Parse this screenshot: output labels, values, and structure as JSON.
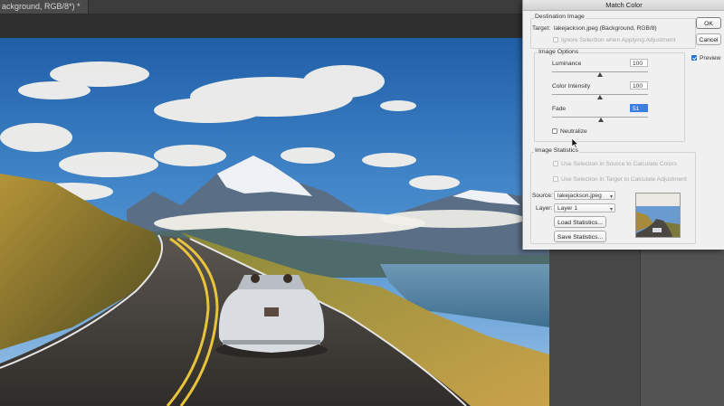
{
  "document": {
    "tab_title": "ackground, RGB/8*) *"
  },
  "dialog": {
    "title": "Match Color",
    "ok_label": "OK",
    "cancel_label": "Cancel",
    "preview_label": "Preview",
    "preview_checked": true,
    "destination": {
      "group_label": "Destination Image",
      "target_label": "Target:",
      "target_value": "lakejackson.jpeg (Background, RGB/8)",
      "ignore_selection_label": "Ignore Selection when Applying Adjustment"
    },
    "image_options": {
      "group_label": "Image Options",
      "luminance": {
        "label": "Luminance",
        "value": "100",
        "level": 0.5
      },
      "color_intensity": {
        "label": "Color Intensity",
        "value": "100",
        "level": 0.5
      },
      "fade": {
        "label": "Fade",
        "value": "51",
        "level": 0.51
      },
      "neutralize_label": "Neutralize"
    },
    "image_statistics": {
      "group_label": "Image Statistics",
      "use_source_selection_label": "Use Selection in Source to Calculate Colors",
      "use_target_selection_label": "Use Selection in Target to Calculate Adjustment",
      "source_label": "Source:",
      "source_value": "lakejackson.jpeg",
      "layer_label": "Layer:",
      "layer_value": "Layer 1",
      "load_button": "Load Statistics...",
      "save_button": "Save Statistics..."
    }
  }
}
